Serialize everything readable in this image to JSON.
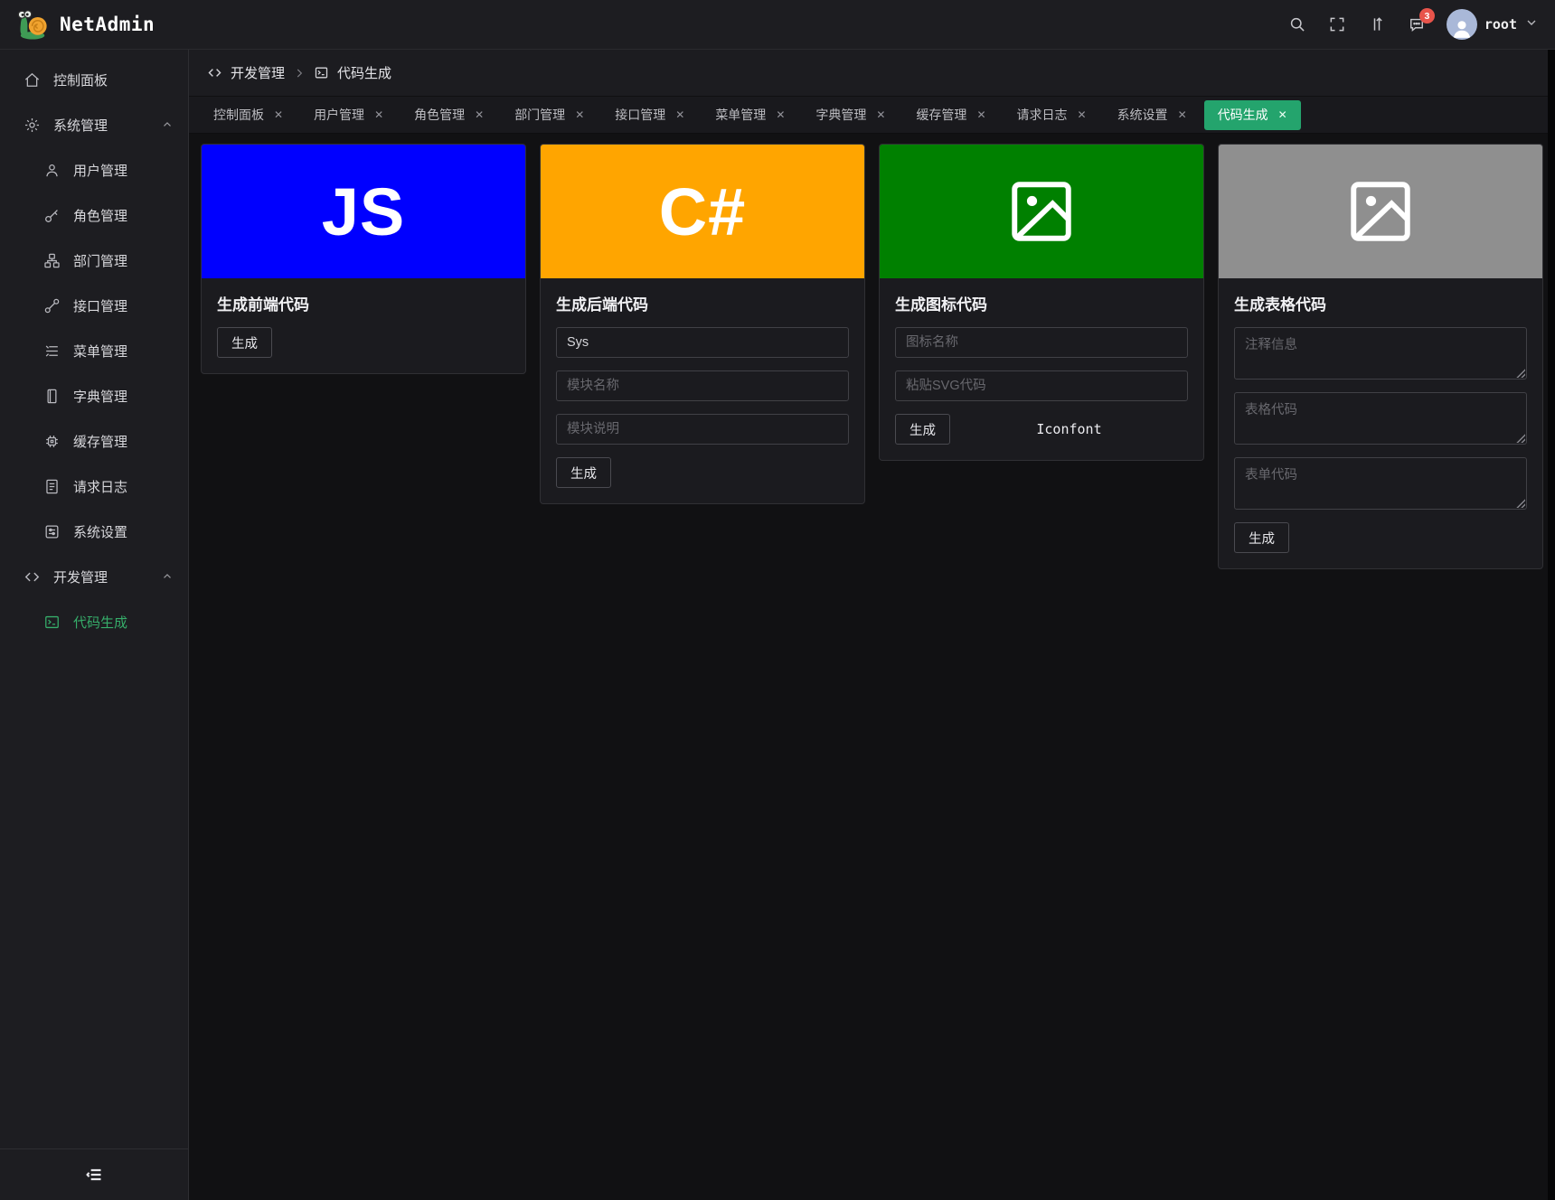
{
  "header": {
    "app_name": "NetAdmin",
    "username": "root",
    "notification_count": "3"
  },
  "breadcrumb": {
    "section": "开发管理",
    "page": "代码生成"
  },
  "tabs": [
    {
      "label": "控制面板",
      "active": false
    },
    {
      "label": "用户管理",
      "active": false
    },
    {
      "label": "角色管理",
      "active": false
    },
    {
      "label": "部门管理",
      "active": false
    },
    {
      "label": "接口管理",
      "active": false
    },
    {
      "label": "菜单管理",
      "active": false
    },
    {
      "label": "字典管理",
      "active": false
    },
    {
      "label": "缓存管理",
      "active": false
    },
    {
      "label": "请求日志",
      "active": false
    },
    {
      "label": "系统设置",
      "active": false
    },
    {
      "label": "代码生成",
      "active": true
    }
  ],
  "ui": {
    "close_glyph": "✕"
  },
  "sidebar": {
    "items": [
      {
        "label": "控制面板",
        "icon": "home-icon",
        "level": 0
      },
      {
        "label": "系统管理",
        "icon": "gear-icon",
        "level": 0,
        "expanded": true
      },
      {
        "label": "用户管理",
        "icon": "user-icon",
        "level": 1
      },
      {
        "label": "角色管理",
        "icon": "key-icon",
        "level": 1
      },
      {
        "label": "部门管理",
        "icon": "org-chart-icon",
        "level": 1
      },
      {
        "label": "接口管理",
        "icon": "api-link-icon",
        "level": 1
      },
      {
        "label": "菜单管理",
        "icon": "menu-lines-icon",
        "level": 1
      },
      {
        "label": "字典管理",
        "icon": "book-icon",
        "level": 1
      },
      {
        "label": "缓存管理",
        "icon": "chip-icon",
        "level": 1
      },
      {
        "label": "请求日志",
        "icon": "log-file-icon",
        "level": 1
      },
      {
        "label": "系统设置",
        "icon": "sliders-icon",
        "level": 1
      },
      {
        "label": "开发管理",
        "icon": "code-icon",
        "level": 0,
        "expanded": true
      },
      {
        "label": "代码生成",
        "icon": "terminal-icon",
        "level": 1,
        "active": true
      }
    ]
  },
  "cards": [
    {
      "title": "生成前端代码",
      "banner_text": "JS",
      "banner_color": "#0000ff",
      "generate_label": "生成"
    },
    {
      "title": "生成后端代码",
      "banner_text": "C#",
      "banner_color": "#ffa500",
      "fields": [
        {
          "value": "Sys"
        },
        {
          "placeholder": "模块名称"
        },
        {
          "placeholder": "模块说明"
        }
      ],
      "generate_label": "生成"
    },
    {
      "title": "生成图标代码",
      "banner_icon": "image-icon",
      "banner_color": "#008000",
      "fields": [
        {
          "placeholder": "图标名称"
        },
        {
          "placeholder": "粘贴SVG代码"
        }
      ],
      "generate_label": "生成",
      "link_label": "Iconfont"
    },
    {
      "title": "生成表格代码",
      "banner_icon": "image-icon",
      "banner_color": "#8f8f8f",
      "textareas": [
        {
          "placeholder": "注释信息"
        },
        {
          "placeholder": "表格代码"
        },
        {
          "placeholder": "表单代码"
        }
      ],
      "generate_label": "生成"
    }
  ],
  "colors": {
    "tab_active_green": "#24a46d",
    "sidebar_active_green": "#36ad6a",
    "badge_red": "#e8544b"
  }
}
